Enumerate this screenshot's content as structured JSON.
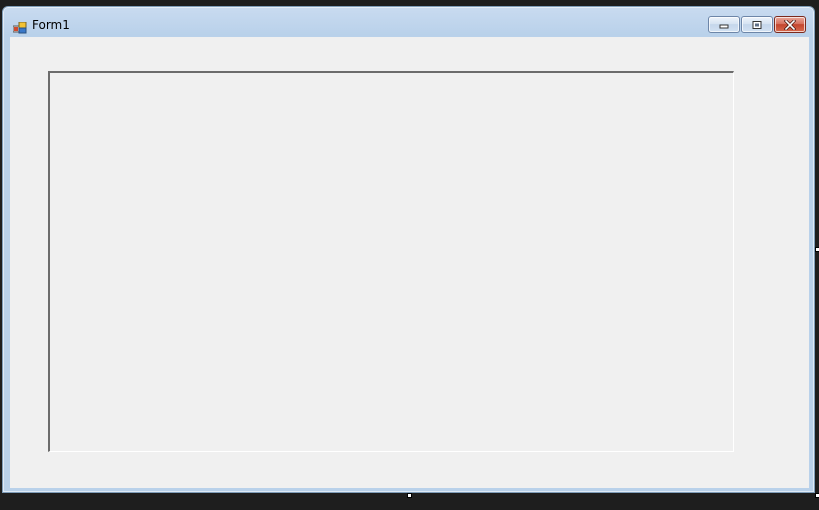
{
  "window": {
    "title": "Form1"
  },
  "icons": {
    "app": "form-app-icon",
    "minimize": "minimize-icon",
    "maximize": "maximize-icon",
    "close": "close-icon"
  },
  "colors": {
    "client_background": "#f0f0f0",
    "title_bar": "#b9d1ea",
    "close_button": "#c3452d",
    "designer_background": "#1e1e1e"
  }
}
